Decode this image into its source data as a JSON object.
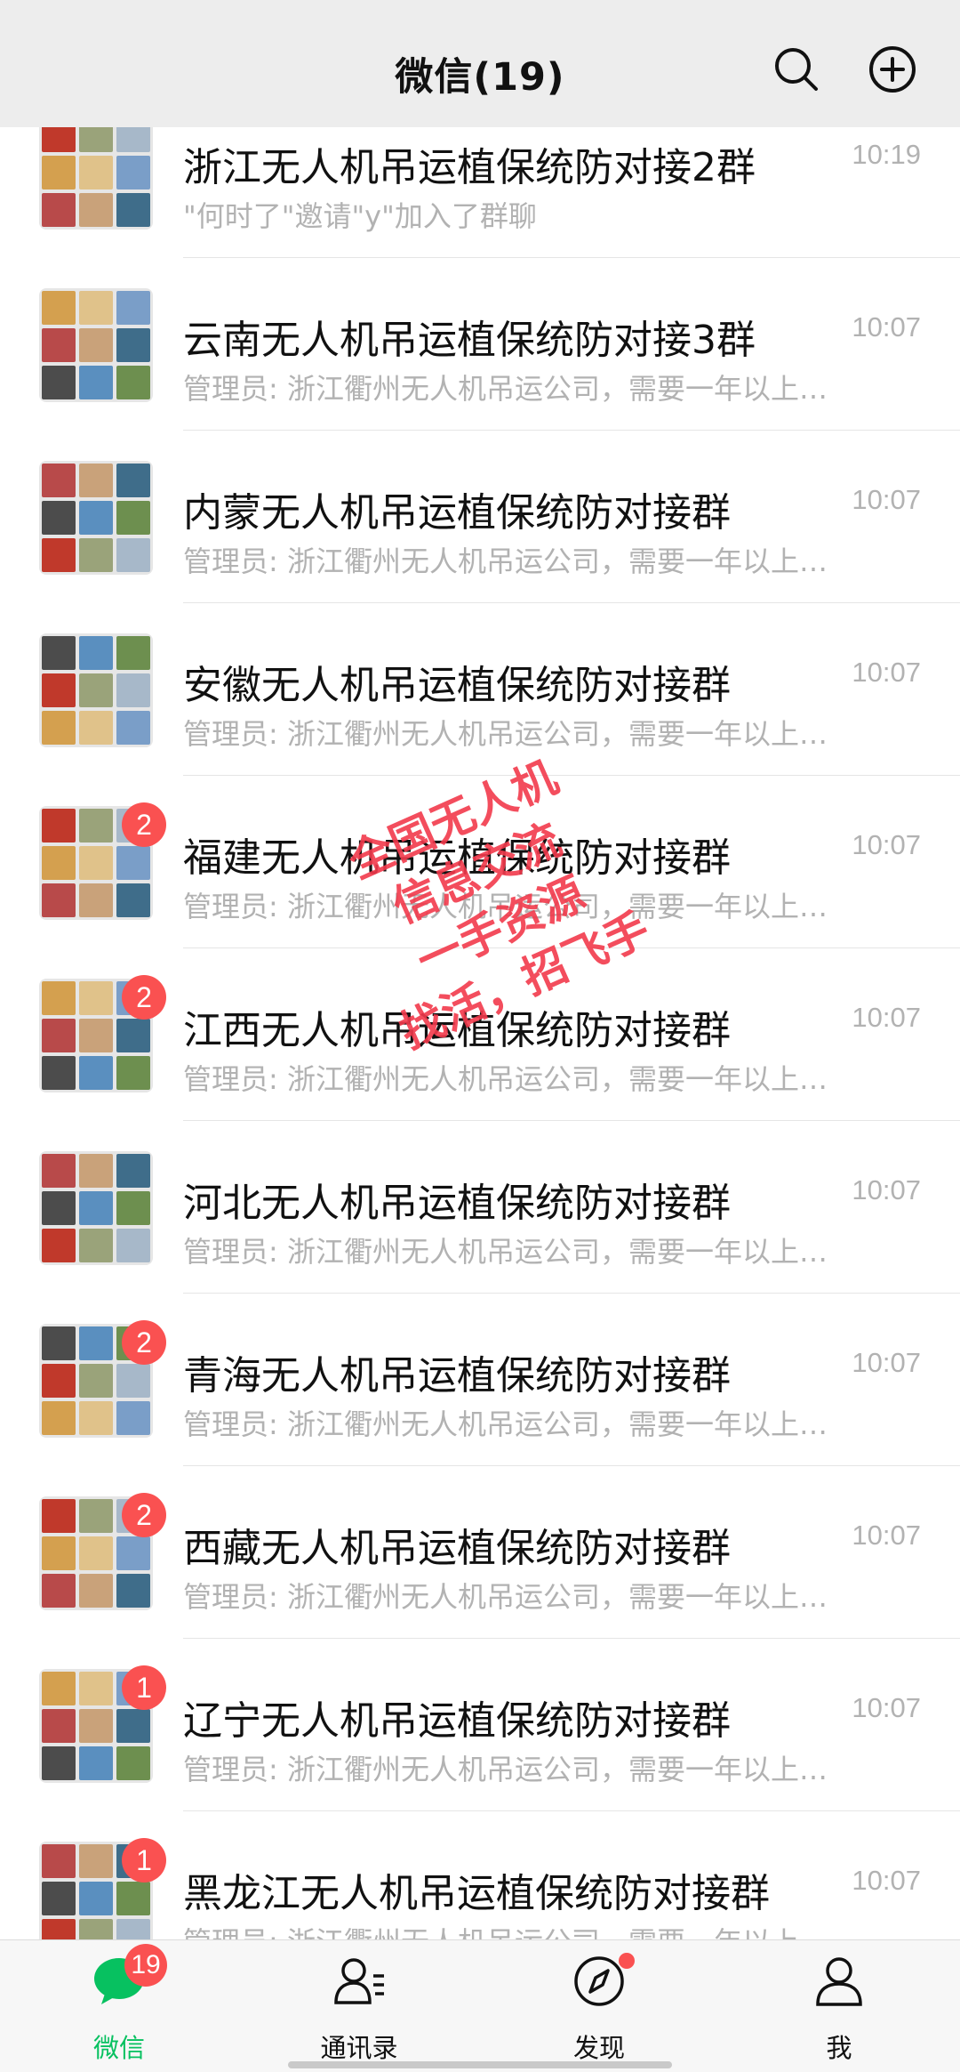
{
  "header": {
    "title": "微信(19)",
    "search_icon": "search-icon",
    "add_icon": "plus-circle-icon"
  },
  "chats": [
    {
      "name": "浙江无人机吊运植保统防对接2群",
      "time": "10:19",
      "preview": "\"何时了\"邀请\"y\"加入了群聊",
      "badge": ""
    },
    {
      "name": "云南无人机吊运植保统防对接3群",
      "time": "10:07",
      "preview": "管理员: 浙江衢州无人机吊运公司，需要一年以上…",
      "badge": ""
    },
    {
      "name": "内蒙无人机吊运植保统防对接群",
      "time": "10:07",
      "preview": "管理员: 浙江衢州无人机吊运公司，需要一年以上…",
      "badge": ""
    },
    {
      "name": "安徽无人机吊运植保统防对接群",
      "time": "10:07",
      "preview": "管理员: 浙江衢州无人机吊运公司，需要一年以上…",
      "badge": ""
    },
    {
      "name": "福建无人机吊运植保统防对接群",
      "time": "10:07",
      "preview": "管理员: 浙江衢州无人机吊运公司，需要一年以上…",
      "badge": "2"
    },
    {
      "name": "江西无人机吊运植保统防对接群",
      "time": "10:07",
      "preview": "管理员: 浙江衢州无人机吊运公司，需要一年以上…",
      "badge": "2"
    },
    {
      "name": "河北无人机吊运植保统防对接群",
      "time": "10:07",
      "preview": "管理员: 浙江衢州无人机吊运公司，需要一年以上…",
      "badge": ""
    },
    {
      "name": "青海无人机吊运植保统防对接群",
      "time": "10:07",
      "preview": "管理员: 浙江衢州无人机吊运公司，需要一年以上…",
      "badge": "2"
    },
    {
      "name": "西藏无人机吊运植保统防对接群",
      "time": "10:07",
      "preview": "管理员: 浙江衢州无人机吊运公司，需要一年以上…",
      "badge": "2"
    },
    {
      "name": "辽宁无人机吊运植保统防对接群",
      "time": "10:07",
      "preview": "管理员: 浙江衢州无人机吊运公司，需要一年以上…",
      "badge": "1"
    },
    {
      "name": "黑龙江无人机吊运植保统防对接群",
      "time": "10:07",
      "preview": "管理员: 浙江衢州无人机吊运公司，需要一年以上…",
      "badge": "1"
    }
  ],
  "watermark": {
    "lines": [
      "全国无人机",
      "信息交流",
      "一手资源",
      "找活，招飞手"
    ]
  },
  "tabbar": {
    "tabs": [
      {
        "label": "微信",
        "icon": "chat-bubble-icon",
        "badge": "19",
        "active": true
      },
      {
        "label": "通讯录",
        "icon": "contacts-icon"
      },
      {
        "label": "发现",
        "icon": "compass-icon",
        "dot": true
      },
      {
        "label": "我",
        "icon": "person-icon"
      }
    ]
  },
  "colors": {
    "accent": "#07c160",
    "badge": "#fa5151",
    "header_bg": "#ededed",
    "secondary_text": "#b2b2b2"
  }
}
